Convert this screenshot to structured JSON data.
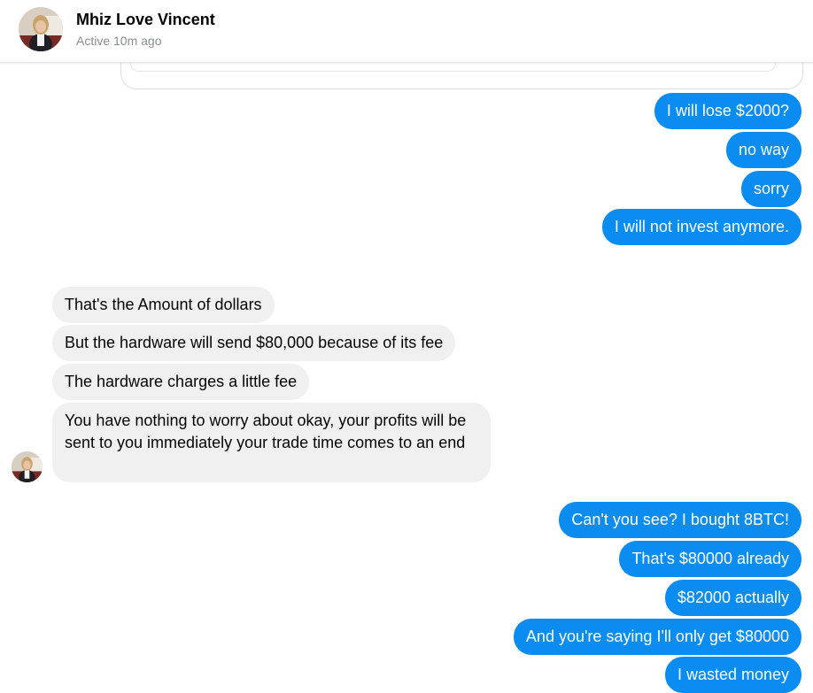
{
  "header": {
    "name": "Mhiz Love Vincent",
    "status": "Active 10m ago"
  },
  "messages": {
    "block1": [
      "I will lose $2000?",
      "no way",
      "sorry",
      "I will not invest anymore."
    ],
    "block2": [
      "That's the Amount of dollars",
      "But the hardware will send $80,000 because of its fee",
      "The hardware charges a little fee",
      "You have nothing to worry about okay, your profits will be sent to you immediately your trade time comes to an end"
    ],
    "block3": [
      "Can't you see? I bought 8BTC!",
      "That's $80000 already",
      "$82000 actually",
      "And you're saying I'll only get $80000",
      "I wasted money"
    ]
  },
  "colors": {
    "outgoing_bubble": "#0a8cf0",
    "incoming_bubble": "#f0f0f0",
    "status_text": "#8a8d91"
  }
}
